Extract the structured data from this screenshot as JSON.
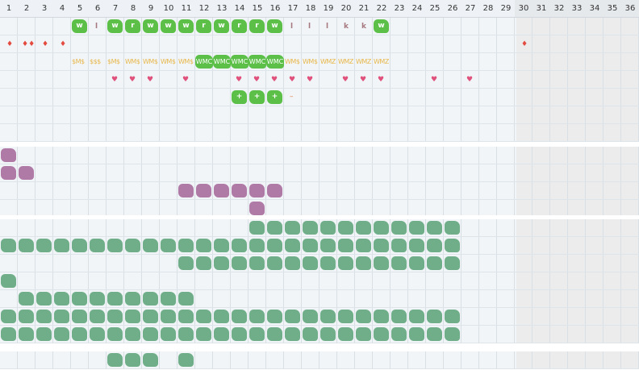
{
  "columns": [
    "1",
    "2",
    "3",
    "4",
    "5",
    "6",
    "7",
    "8",
    "9",
    "10",
    "11",
    "12",
    "13",
    "14",
    "15",
    "16",
    "17",
    "18",
    "19",
    "20",
    "21",
    "22",
    "23",
    "24",
    "25",
    "26",
    "27",
    "28",
    "29",
    "30",
    "31",
    "32",
    "33",
    "34",
    "35",
    "36"
  ],
  "weekend_from_column": 30,
  "colors": {
    "green": "#5cbf48",
    "purple": "#b07aa6",
    "sage": "#6fae88",
    "heart": "#e0517b",
    "drop": "#e34b3f",
    "money": "#e8b74a",
    "letter": "#a6797f",
    "minus": "#e8733a"
  },
  "row_w": [
    {
      "col": 5,
      "text": "w",
      "style": "green"
    },
    {
      "col": 6,
      "text": "l",
      "style": "letter"
    },
    {
      "col": 7,
      "text": "w",
      "style": "green"
    },
    {
      "col": 8,
      "text": "r",
      "style": "green"
    },
    {
      "col": 9,
      "text": "w",
      "style": "green"
    },
    {
      "col": 10,
      "text": "w",
      "style": "green"
    },
    {
      "col": 11,
      "text": "w",
      "style": "green"
    },
    {
      "col": 12,
      "text": "r",
      "style": "green"
    },
    {
      "col": 13,
      "text": "w",
      "style": "green"
    },
    {
      "col": 14,
      "text": "r",
      "style": "green"
    },
    {
      "col": 15,
      "text": "r",
      "style": "green"
    },
    {
      "col": 16,
      "text": "w",
      "style": "green"
    },
    {
      "col": 17,
      "text": "l",
      "style": "letter"
    },
    {
      "col": 18,
      "text": "l",
      "style": "letter"
    },
    {
      "col": 19,
      "text": "l",
      "style": "letter"
    },
    {
      "col": 20,
      "text": "k",
      "style": "letter"
    },
    {
      "col": 21,
      "text": "k",
      "style": "letter"
    },
    {
      "col": 22,
      "text": "w",
      "style": "green"
    }
  ],
  "row_drops": [
    {
      "col": 1,
      "text": "♦"
    },
    {
      "col": 2,
      "text": "♦♦"
    },
    {
      "col": 3,
      "text": "♦"
    },
    {
      "col": 4,
      "text": "♦"
    },
    {
      "col": 30,
      "text": "♦"
    }
  ],
  "row_money": [
    {
      "col": 5,
      "text": "$M$",
      "boxed": false
    },
    {
      "col": 6,
      "text": "$$$",
      "boxed": false
    },
    {
      "col": 7,
      "text": "$M$",
      "boxed": false
    },
    {
      "col": 8,
      "text": "WM$",
      "boxed": false
    },
    {
      "col": 9,
      "text": "WM$",
      "boxed": false
    },
    {
      "col": 10,
      "text": "WM$",
      "boxed": false
    },
    {
      "col": 11,
      "text": "WM$",
      "boxed": false
    },
    {
      "col": 12,
      "text": "WMC",
      "boxed": true
    },
    {
      "col": 13,
      "text": "WMC",
      "boxed": true
    },
    {
      "col": 14,
      "text": "WMC",
      "boxed": true
    },
    {
      "col": 15,
      "text": "WMC",
      "boxed": true
    },
    {
      "col": 16,
      "text": "WMC",
      "boxed": true
    },
    {
      "col": 17,
      "text": "WM$",
      "boxed": false
    },
    {
      "col": 18,
      "text": "WM$",
      "boxed": false
    },
    {
      "col": 19,
      "text": "WMZ",
      "boxed": false
    },
    {
      "col": 20,
      "text": "WMZ",
      "boxed": false
    },
    {
      "col": 21,
      "text": "WMZ",
      "boxed": false
    },
    {
      "col": 22,
      "text": "WMZ",
      "boxed": false
    }
  ],
  "row_hearts": [
    7,
    8,
    9,
    11,
    14,
    15,
    16,
    17,
    18,
    20,
    21,
    22,
    25,
    27
  ],
  "heart_glyph": "♥",
  "row_plus": [
    {
      "col": 14,
      "text": "+",
      "style": "green"
    },
    {
      "col": 15,
      "text": "+",
      "style": "green"
    },
    {
      "col": 16,
      "text": "+",
      "style": "green"
    },
    {
      "col": 17,
      "text": "–",
      "style": "minus"
    }
  ],
  "purple_rows": [
    [
      1
    ],
    [
      1,
      2
    ],
    [
      11,
      12,
      13,
      14,
      15,
      16
    ],
    [
      15
    ]
  ],
  "sage_rows": [
    [
      15,
      16,
      17,
      18,
      19,
      20,
      21,
      22,
      23,
      24,
      25,
      26
    ],
    [
      1,
      2,
      3,
      4,
      5,
      6,
      7,
      8,
      9,
      10,
      11,
      12,
      13,
      14,
      15,
      16,
      17,
      18,
      19,
      20,
      21,
      22,
      23,
      24,
      25,
      26
    ],
    [
      11,
      12,
      13,
      14,
      15,
      16,
      17,
      18,
      19,
      20,
      21,
      22,
      23,
      24,
      25,
      26
    ],
    [
      1
    ],
    [
      2,
      3,
      4,
      5,
      6,
      7,
      8,
      9,
      10,
      11
    ],
    [
      1,
      2,
      3,
      4,
      5,
      6,
      7,
      8,
      9,
      10,
      11,
      12,
      13,
      14,
      15,
      16,
      17,
      18,
      19,
      20,
      21,
      22,
      23,
      24,
      25,
      26
    ],
    [
      1,
      2,
      3,
      4,
      5,
      6,
      7,
      8,
      9,
      10,
      11,
      12,
      13,
      14,
      15,
      16,
      17,
      18,
      19,
      20,
      21,
      22,
      23,
      24,
      25,
      26
    ]
  ],
  "bottom_row": [
    7,
    8,
    9,
    11
  ]
}
